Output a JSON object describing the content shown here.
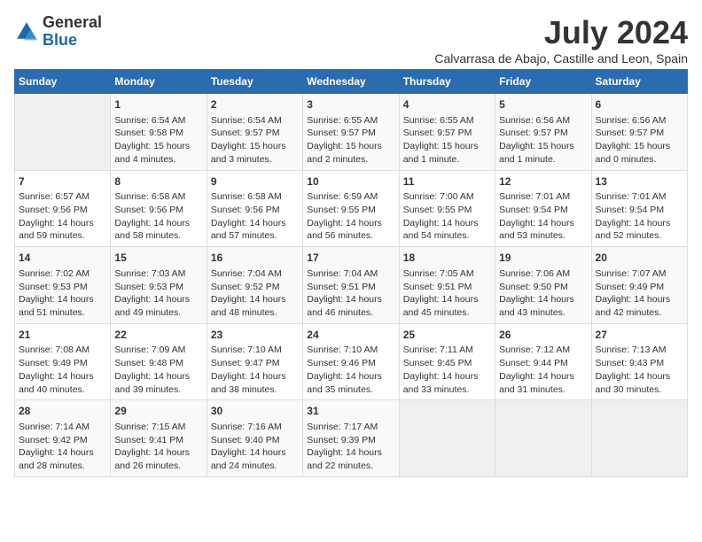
{
  "logo": {
    "general": "General",
    "blue": "Blue"
  },
  "title": "July 2024",
  "location": "Calvarrasa de Abajo, Castille and Leon, Spain",
  "columns": [
    "Sunday",
    "Monday",
    "Tuesday",
    "Wednesday",
    "Thursday",
    "Friday",
    "Saturday"
  ],
  "weeks": [
    [
      {
        "day": "",
        "info": ""
      },
      {
        "day": "1",
        "info": "Sunrise: 6:54 AM\nSunset: 9:58 PM\nDaylight: 15 hours\nand 4 minutes."
      },
      {
        "day": "2",
        "info": "Sunrise: 6:54 AM\nSunset: 9:57 PM\nDaylight: 15 hours\nand 3 minutes."
      },
      {
        "day": "3",
        "info": "Sunrise: 6:55 AM\nSunset: 9:57 PM\nDaylight: 15 hours\nand 2 minutes."
      },
      {
        "day": "4",
        "info": "Sunrise: 6:55 AM\nSunset: 9:57 PM\nDaylight: 15 hours\nand 1 minute."
      },
      {
        "day": "5",
        "info": "Sunrise: 6:56 AM\nSunset: 9:57 PM\nDaylight: 15 hours\nand 1 minute."
      },
      {
        "day": "6",
        "info": "Sunrise: 6:56 AM\nSunset: 9:57 PM\nDaylight: 15 hours\nand 0 minutes."
      }
    ],
    [
      {
        "day": "7",
        "info": "Sunrise: 6:57 AM\nSunset: 9:56 PM\nDaylight: 14 hours\nand 59 minutes."
      },
      {
        "day": "8",
        "info": "Sunrise: 6:58 AM\nSunset: 9:56 PM\nDaylight: 14 hours\nand 58 minutes."
      },
      {
        "day": "9",
        "info": "Sunrise: 6:58 AM\nSunset: 9:56 PM\nDaylight: 14 hours\nand 57 minutes."
      },
      {
        "day": "10",
        "info": "Sunrise: 6:59 AM\nSunset: 9:55 PM\nDaylight: 14 hours\nand 56 minutes."
      },
      {
        "day": "11",
        "info": "Sunrise: 7:00 AM\nSunset: 9:55 PM\nDaylight: 14 hours\nand 54 minutes."
      },
      {
        "day": "12",
        "info": "Sunrise: 7:01 AM\nSunset: 9:54 PM\nDaylight: 14 hours\nand 53 minutes."
      },
      {
        "day": "13",
        "info": "Sunrise: 7:01 AM\nSunset: 9:54 PM\nDaylight: 14 hours\nand 52 minutes."
      }
    ],
    [
      {
        "day": "14",
        "info": "Sunrise: 7:02 AM\nSunset: 9:53 PM\nDaylight: 14 hours\nand 51 minutes."
      },
      {
        "day": "15",
        "info": "Sunrise: 7:03 AM\nSunset: 9:53 PM\nDaylight: 14 hours\nand 49 minutes."
      },
      {
        "day": "16",
        "info": "Sunrise: 7:04 AM\nSunset: 9:52 PM\nDaylight: 14 hours\nand 48 minutes."
      },
      {
        "day": "17",
        "info": "Sunrise: 7:04 AM\nSunset: 9:51 PM\nDaylight: 14 hours\nand 46 minutes."
      },
      {
        "day": "18",
        "info": "Sunrise: 7:05 AM\nSunset: 9:51 PM\nDaylight: 14 hours\nand 45 minutes."
      },
      {
        "day": "19",
        "info": "Sunrise: 7:06 AM\nSunset: 9:50 PM\nDaylight: 14 hours\nand 43 minutes."
      },
      {
        "day": "20",
        "info": "Sunrise: 7:07 AM\nSunset: 9:49 PM\nDaylight: 14 hours\nand 42 minutes."
      }
    ],
    [
      {
        "day": "21",
        "info": "Sunrise: 7:08 AM\nSunset: 9:49 PM\nDaylight: 14 hours\nand 40 minutes."
      },
      {
        "day": "22",
        "info": "Sunrise: 7:09 AM\nSunset: 9:48 PM\nDaylight: 14 hours\nand 39 minutes."
      },
      {
        "day": "23",
        "info": "Sunrise: 7:10 AM\nSunset: 9:47 PM\nDaylight: 14 hours\nand 38 minutes."
      },
      {
        "day": "24",
        "info": "Sunrise: 7:10 AM\nSunset: 9:46 PM\nDaylight: 14 hours\nand 35 minutes."
      },
      {
        "day": "25",
        "info": "Sunrise: 7:11 AM\nSunset: 9:45 PM\nDaylight: 14 hours\nand 33 minutes."
      },
      {
        "day": "26",
        "info": "Sunrise: 7:12 AM\nSunset: 9:44 PM\nDaylight: 14 hours\nand 31 minutes."
      },
      {
        "day": "27",
        "info": "Sunrise: 7:13 AM\nSunset: 9:43 PM\nDaylight: 14 hours\nand 30 minutes."
      }
    ],
    [
      {
        "day": "28",
        "info": "Sunrise: 7:14 AM\nSunset: 9:42 PM\nDaylight: 14 hours\nand 28 minutes."
      },
      {
        "day": "29",
        "info": "Sunrise: 7:15 AM\nSunset: 9:41 PM\nDaylight: 14 hours\nand 26 minutes."
      },
      {
        "day": "30",
        "info": "Sunrise: 7:16 AM\nSunset: 9:40 PM\nDaylight: 14 hours\nand 24 minutes."
      },
      {
        "day": "31",
        "info": "Sunrise: 7:17 AM\nSunset: 9:39 PM\nDaylight: 14 hours\nand 22 minutes."
      },
      {
        "day": "",
        "info": ""
      },
      {
        "day": "",
        "info": ""
      },
      {
        "day": "",
        "info": ""
      }
    ]
  ]
}
